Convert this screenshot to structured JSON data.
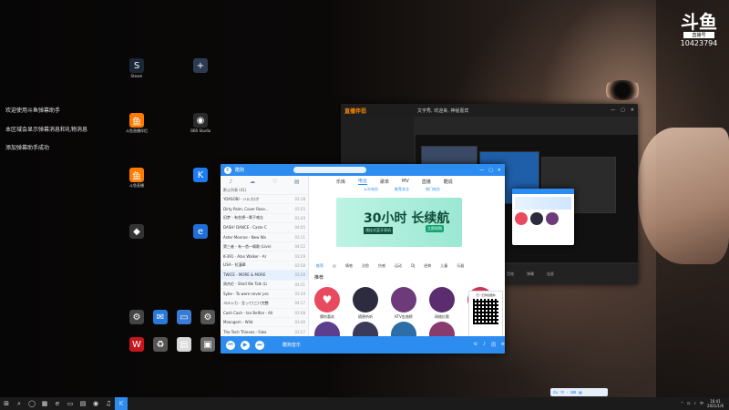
{
  "desktop": {
    "icons": [
      {
        "label": "Steam",
        "icon": "steam-icon",
        "color": "#1b2838",
        "glyph": "S"
      },
      {
        "label": "",
        "icon": "app-icon",
        "color": "#2d3b52",
        "glyph": "+"
      },
      {
        "label": "斗鱼直播伴侣",
        "icon": "douyu-companion-icon",
        "color": "#ff7a00",
        "glyph": "鱼"
      },
      {
        "label": "OBS Studio",
        "icon": "obs-icon",
        "color": "#2b2b2b",
        "glyph": "◉"
      },
      {
        "label": "斗鱼直播",
        "icon": "douyu-live-icon",
        "color": "#ff7a00",
        "glyph": "鱼"
      },
      {
        "label": "",
        "icon": "kugou-icon",
        "color": "#1d7cf2",
        "glyph": "K"
      },
      {
        "label": "",
        "icon": "game-icon",
        "color": "#333333",
        "glyph": "◆"
      },
      {
        "label": "",
        "icon": "browser-icon",
        "color": "#1f6fd6",
        "glyph": "e"
      },
      {
        "label": "",
        "icon": "settings-icon",
        "color": "#444444",
        "glyph": "⚙"
      },
      {
        "label": "",
        "icon": "mail-icon",
        "color": "#2979d9",
        "glyph": "✉"
      },
      {
        "label": "",
        "icon": "computer-icon",
        "color": "#3a7bd5",
        "glyph": "▭"
      },
      {
        "label": "",
        "icon": "gear-icon",
        "color": "#555555",
        "glyph": "⚙"
      },
      {
        "label": "",
        "icon": "wps-icon",
        "color": "#c4161c",
        "glyph": "W"
      },
      {
        "label": "",
        "icon": "recycle-bin-icon",
        "color": "#555555",
        "glyph": "♻"
      },
      {
        "label": "",
        "icon": "file-icon",
        "color": "#d9d9d9",
        "glyph": "▤"
      },
      {
        "label": "",
        "icon": "image-icon",
        "color": "#6a6a6a",
        "glyph": "▣"
      }
    ],
    "notices": [
      "欢迎使用斗鱼弹幕助手",
      "本区域会显示弹幕消息和礼物消息",
      "添加弹幕助手成功"
    ],
    "watermark": {
      "logo": "斗鱼",
      "sub": "直播号",
      "room": "10423794"
    }
  },
  "studio": {
    "brand": "直播伴侣",
    "title_extra": "文字秀, 欢迎来, 神秘嘉宾",
    "bottom": [
      "音效",
      "弹幕",
      "连麦"
    ]
  },
  "player": {
    "title": "酷狗",
    "left_tabs": [
      "♪",
      "☁",
      "♡",
      "▤"
    ],
    "list_header": "默认列表 (41)",
    "songs": [
      {
        "title": "YOASOBI - ハルカ(ボ",
        "dur": "03:18"
      },
      {
        "title": "Dirty Palm, Cover Rose...",
        "dur": "03:25"
      },
      {
        "title": "旧梦 - 有些想一辈子难忘",
        "dur": "03:43"
      },
      {
        "title": "DASH! DANCE - Caste C",
        "dur": "04:05"
      },
      {
        "title": "Aster Monroe - New Wa",
        "dur": "03:11"
      },
      {
        "title": "第三者 - 有一首一辆歌 (Live)",
        "dur": "04:52"
      },
      {
        "title": "K-391 - Alan Walker - Ar",
        "dur": "03:29"
      },
      {
        "title": "LISA - 紅蓮華",
        "dur": "03:58"
      },
      {
        "title": "TWICE - MORE & MORE",
        "dur": "03:20"
      },
      {
        "title": "周杰伦 - Shall We Talk (Li",
        "dur": "04:21"
      },
      {
        "title": "Sybe - To were never pro",
        "dur": "03:34"
      },
      {
        "title": "ヨルシカ - 言って(三) (完整",
        "dur": "04:17"
      },
      {
        "title": "Cash Cash - Ian Belfon - All",
        "dur": "03:08"
      },
      {
        "title": "Moongem - Wild",
        "dur": "03:40"
      },
      {
        "title": "The Tech Thieves - Fake",
        "dur": "03:27"
      }
    ],
    "tabs": [
      "乐库",
      "电台",
      "歌单",
      "MV",
      "直播",
      "酷说"
    ],
    "active_tab": "电台",
    "sub_tabs": [
      "公众电台",
      "推荐关注",
      "热门电台"
    ],
    "banner": {
      "headline": "30小时 长续航",
      "tag": "颈挂式蓝牙耳机",
      "cta": "立即抢购"
    },
    "categories": [
      "推荐",
      "心",
      "情感",
      "治愈",
      "伤感",
      "运动",
      "DJ",
      "经典",
      "儿童",
      "乐器"
    ],
    "active_category": "推荐",
    "rec_title": "推荐",
    "avatars": [
      {
        "label": "猜你喜欢",
        "color": "#e84a5f"
      },
      {
        "label": "随便听听",
        "color": "#2c2c3e"
      },
      {
        "label": "KTV金曲榜",
        "color": "#6d3b7a"
      },
      {
        "label": "网络红歌",
        "color": "#5b2c6f"
      },
      {
        "label": "抖音热歌",
        "color": "#c7365f"
      }
    ],
    "row2_avatars": [
      {
        "label": "",
        "color": "#5d3e8c"
      },
      {
        "label": "",
        "color": "#3b3b59"
      },
      {
        "label": "",
        "color": "#2e6ea8"
      },
      {
        "label": "",
        "color": "#8a3b6e"
      }
    ],
    "qr_text": "扫一扫添加酷狗",
    "now_playing": "酷狗音乐",
    "accent": "#2d8cf0"
  },
  "taskbar": {
    "apps": [
      "⊞",
      "⌕",
      "◯",
      "▦",
      "e",
      "▭",
      "▤",
      "◉",
      "♫",
      "K"
    ],
    "tray": [
      "⌃",
      "⊡",
      "♪",
      "中"
    ],
    "time": "16:41",
    "date": "2021/1/6",
    "floatbar": [
      "du",
      "中",
      "·",
      "⌨",
      "▦"
    ]
  }
}
